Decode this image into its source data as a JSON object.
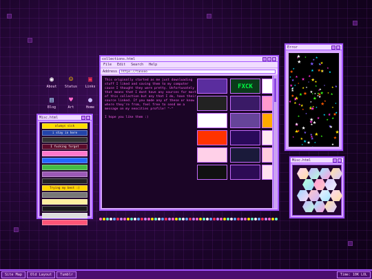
{
  "desktop_icons": [
    {
      "label": "About",
      "icon": "about-icon"
    },
    {
      "label": "Status",
      "icon": "status-icon"
    },
    {
      "label": "Links",
      "icon": "links-icon"
    },
    {
      "label": "Blog",
      "icon": "blog-icon"
    },
    {
      "label": "Art",
      "icon": "art-icon"
    },
    {
      "label": "Home",
      "icon": "home-icon"
    }
  ],
  "main_window": {
    "title": "collections.html",
    "menu": [
      "File",
      "Edit",
      "Search",
      "Help"
    ],
    "address_label": "Address",
    "address_value": "https://tanooo",
    "intro_p1": "This originally started as me just downloading stuff I liked and saving them to my computer cause I thought they were pretty. Unfortunately that means that I dont have any sources for most of this collection but any that I do, have their source linked. If you made any of these or know where they're from, feel free to send me a message on my neocities profile! ^-^",
    "intro_p2": "I hope you like them :)",
    "grid_labels": [
      "",
      "FXCK",
      "",
      "",
      "",
      "",
      "",
      "",
      "",
      "",
      "",
      "",
      "",
      "",
      "",
      "",
      "",
      "",
      ""
    ]
  },
  "misc_left": {
    "title": "Misc.html",
    "stamps": [
      "always sick",
      "i stay in here",
      "",
      "I fucking forgot",
      "",
      "",
      "",
      "",
      "",
      "Trying my best :)",
      "",
      "",
      "",
      "",
      ""
    ]
  },
  "error_window": {
    "title": "Error"
  },
  "misc_right": {
    "title": "Misc.html"
  },
  "taskbar": {
    "buttons": [
      "Site Map",
      "Old Layout",
      "Tumblr"
    ],
    "clock": "Time: 10K LOL"
  },
  "colors": {
    "accent": "#a255ff",
    "text_pink": "#ff5ef2",
    "window_bg": "#d9a8ff"
  }
}
